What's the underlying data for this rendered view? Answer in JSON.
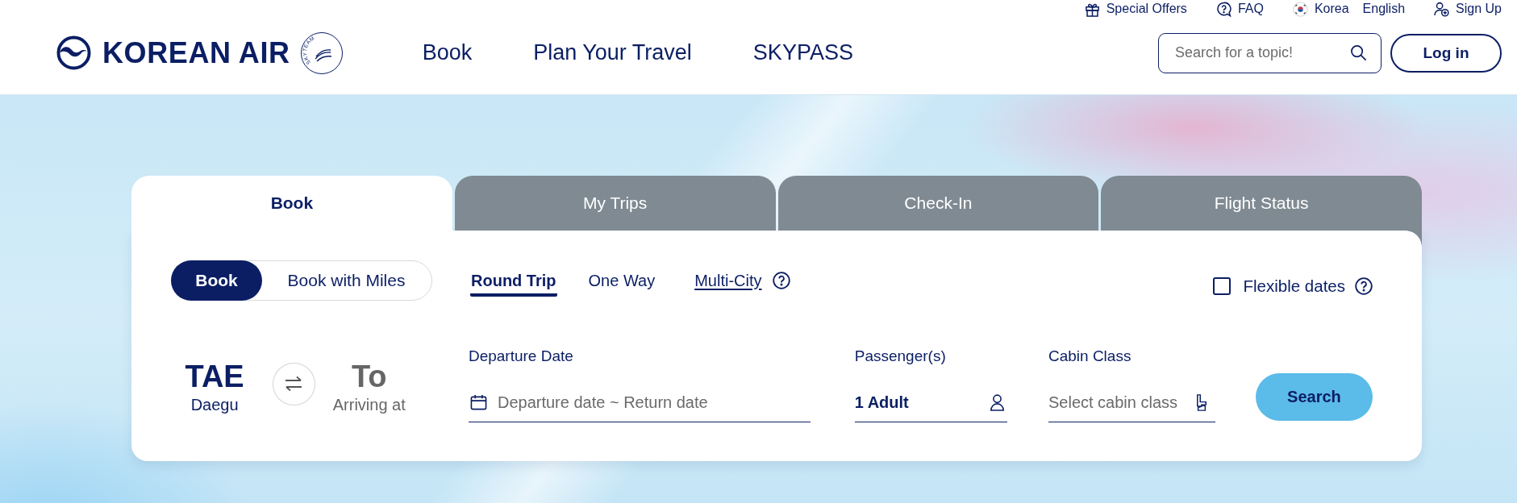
{
  "header": {
    "utility_links": [
      {
        "label": "Special Offers"
      },
      {
        "label": "FAQ"
      },
      {
        "label": "Korea",
        "language": "English"
      },
      {
        "label": "Sign Up"
      }
    ],
    "logo": {
      "brand": "KOREAN AIR",
      "emblem_text": "SKYTEAM"
    },
    "nav": [
      {
        "label": "Book"
      },
      {
        "label": "Plan Your Travel"
      },
      {
        "label": "SKYPASS"
      }
    ],
    "search": {
      "placeholder": "Search for a topic!"
    },
    "login_button": "Log in"
  },
  "booking": {
    "tabs": [
      {
        "label": "Book",
        "selected": true
      },
      {
        "label": "My Trips",
        "selected": false
      },
      {
        "label": "Check-In",
        "selected": false
      },
      {
        "label": "Flight Status",
        "selected": false
      }
    ],
    "modes": [
      {
        "label": "Book",
        "selected": true
      },
      {
        "label": "Book with Miles",
        "selected": false
      }
    ],
    "trip_types": [
      {
        "label": "Round Trip",
        "selected": true,
        "kind": "option"
      },
      {
        "label": "One Way",
        "selected": false,
        "kind": "option"
      },
      {
        "label": "Multi-City",
        "selected": false,
        "kind": "link"
      }
    ],
    "flexible_dates": {
      "label": "Flexible dates",
      "checked": false
    },
    "route": [
      {
        "code": "TAE",
        "city": "Daegu",
        "filled": true
      },
      {
        "code": "To",
        "city": "Arriving at",
        "filled": false
      }
    ],
    "departure_date": {
      "label": "Departure Date",
      "placeholder": "Departure date ~ Return date"
    },
    "passengers": {
      "label": "Passenger(s)",
      "value": "1 Adult"
    },
    "cabin_class": {
      "label": "Cabin Class",
      "placeholder": "Select cabin class"
    },
    "search_button": "Search"
  }
}
